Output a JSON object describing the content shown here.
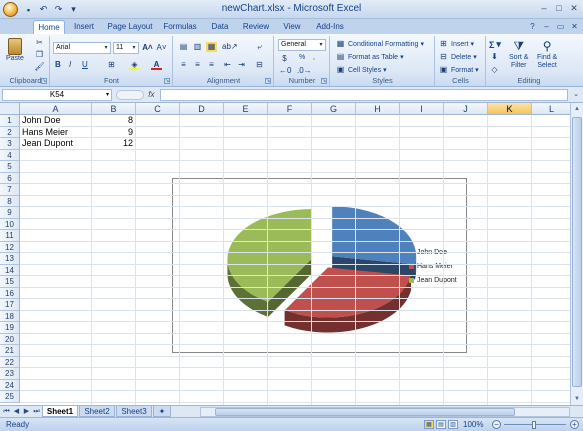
{
  "window": {
    "title": "newChart.xlsx - Microsoft Excel"
  },
  "qat": {
    "save_icon": "save-icon",
    "undo": "↶",
    "redo": "↷",
    "more": "▾"
  },
  "tabs": [
    {
      "label": "Home"
    },
    {
      "label": "Insert"
    },
    {
      "label": "Page Layout"
    },
    {
      "label": "Formulas"
    },
    {
      "label": "Data"
    },
    {
      "label": "Review"
    },
    {
      "label": "View"
    },
    {
      "label": "Add-Ins"
    }
  ],
  "ribbon": {
    "clipboard": {
      "label": "Clipboard",
      "paste": "Paste"
    },
    "font": {
      "label": "Font",
      "name": "Arial",
      "size": "11",
      "bold": "B",
      "italic": "I",
      "underline": "U"
    },
    "alignment": {
      "label": "Alignment"
    },
    "number": {
      "label": "Number",
      "format": "General",
      "percent": "%",
      "comma": ","
    },
    "styles": {
      "label": "Styles",
      "conditional": "Conditional Formatting",
      "table": "Format as Table",
      "cell": "Cell Styles"
    },
    "cells": {
      "label": "Cells",
      "insert": "Insert",
      "delete": "Delete",
      "format": "Format"
    },
    "editing": {
      "label": "Editing",
      "sort1": "Sort &",
      "sort2": "Filter",
      "find1": "Find &",
      "find2": "Select",
      "sum": "Σ"
    }
  },
  "formula_bar": {
    "name_box": "K54",
    "fx": "fx",
    "content": ""
  },
  "columns": [
    "A",
    "B",
    "C",
    "D",
    "E",
    "F",
    "G",
    "H",
    "I",
    "J",
    "K",
    "L"
  ],
  "selected_column": "K",
  "rows": [
    "1",
    "2",
    "3",
    "4",
    "5",
    "6",
    "7",
    "8",
    "9",
    "10",
    "11",
    "12",
    "13",
    "14",
    "15",
    "16",
    "17",
    "18",
    "19",
    "20",
    "21",
    "22",
    "23",
    "24",
    "25"
  ],
  "cells": [
    {
      "name": "John Doe",
      "value": "8"
    },
    {
      "name": "Hans Meier",
      "value": "9"
    },
    {
      "name": "Jean Dupont",
      "value": "12"
    }
  ],
  "chart_data": {
    "type": "pie",
    "title": "",
    "categories": [
      "John Doe",
      "Hans Meier",
      "Jean Dupont"
    ],
    "values": [
      8,
      9,
      12
    ],
    "colors": [
      "#4f81bd",
      "#c0504d",
      "#9bbb59"
    ],
    "exploded": true,
    "three_d": true,
    "legend_position": "right"
  },
  "sheets": [
    {
      "label": "Sheet1"
    },
    {
      "label": "Sheet2"
    },
    {
      "label": "Sheet3"
    }
  ],
  "active_sheet": "Sheet1",
  "status": {
    "text": "Ready",
    "zoom": "100%"
  }
}
